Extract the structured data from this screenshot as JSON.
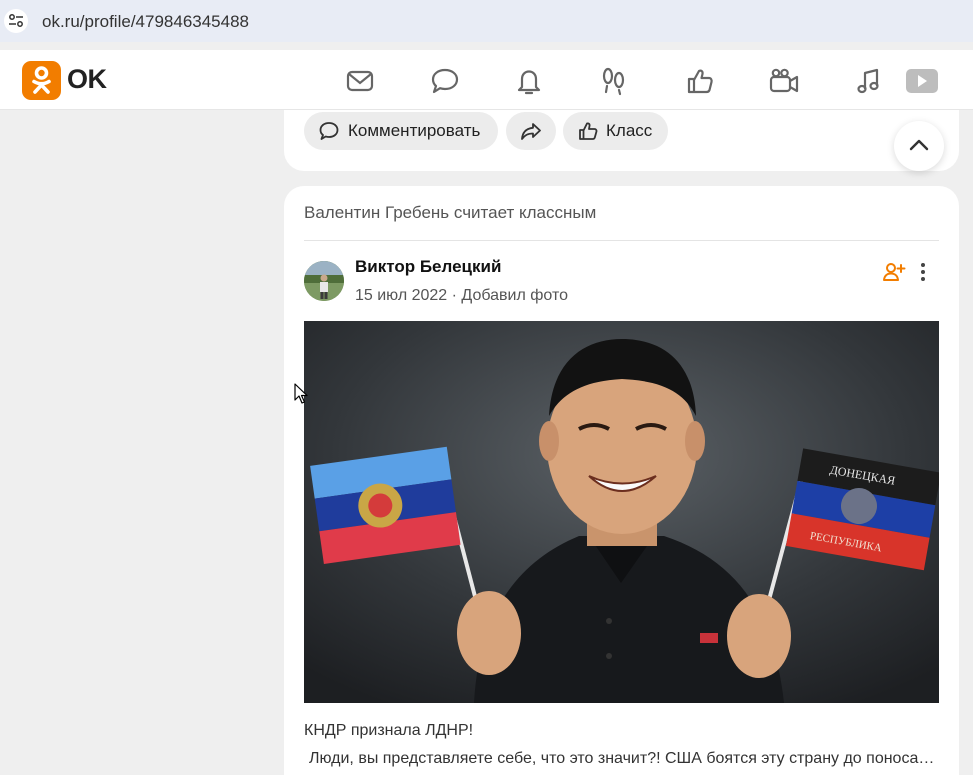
{
  "browser": {
    "url": "ok.ru/profile/479846345488"
  },
  "header": {
    "logo_text": "OK",
    "brand_color": "#f27d00",
    "nav_icons": [
      "messages-icon",
      "discussions-icon",
      "notifications-icon",
      "guests-icon",
      "events-icon",
      "video-calls-icon",
      "music-icon",
      "video-icon"
    ]
  },
  "prev_post": {
    "comment_label": "Комментировать",
    "like_label": "Класс"
  },
  "post": {
    "liked_by": "Валентин Гребень считает классным",
    "author": "Виктор Белецкий",
    "date": "15 июл 2022",
    "separator": " · ",
    "action": "Добавил фото",
    "caption": "КНДР признала ЛДНР!",
    "text": "Люди, вы представляете себе, что это значит?! США боятся эту страну до поноса, а тут ещё и мы"
  },
  "photo": {
    "left_flag_colors": [
      "#5aa0e6",
      "#1f3c9c",
      "#e03b4a"
    ],
    "right_flag_colors": [
      "#1c1c1c",
      "#1d3fa6",
      "#d8342a"
    ],
    "right_flag_text_top": "ДОНЕЦКАЯ",
    "right_flag_text_bottom": "РЕСПУБЛИКА"
  }
}
